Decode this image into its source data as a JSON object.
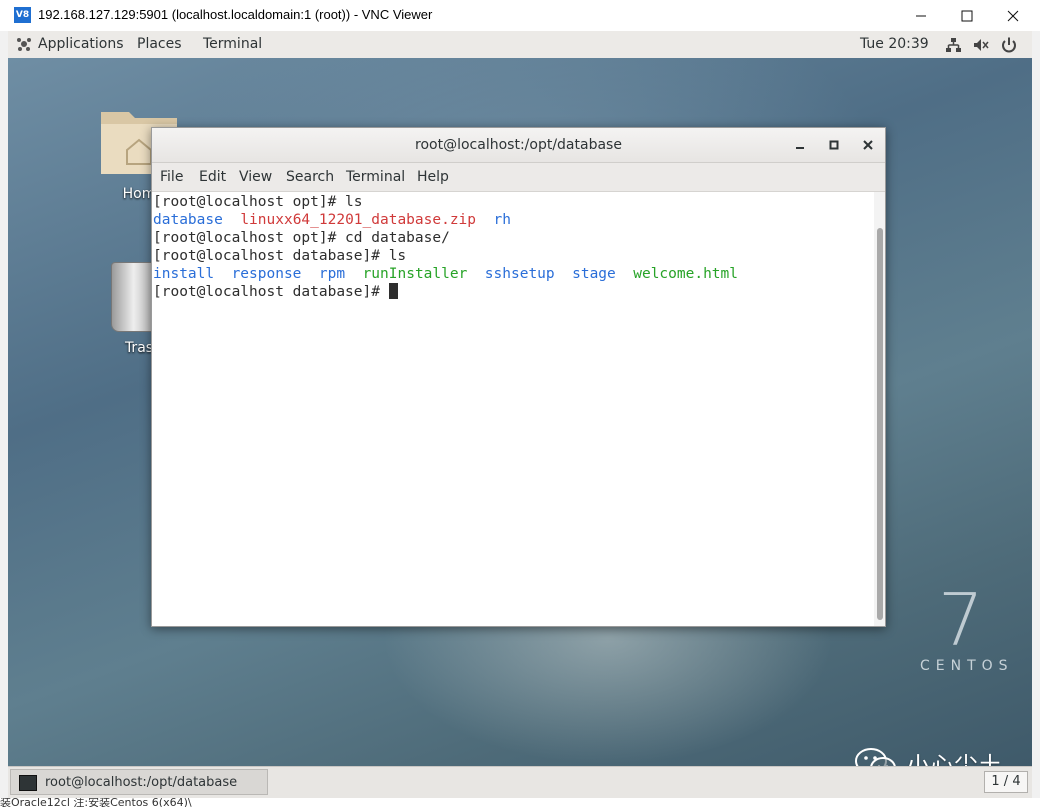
{
  "vnc": {
    "logo": "V8",
    "title": "192.168.127.129:5901 (localhost.localdomain:1 (root)) - VNC Viewer"
  },
  "topbar": {
    "applications": "Applications",
    "places": "Places",
    "terminal": "Terminal",
    "clock": "Tue 20:39"
  },
  "desktop": {
    "home_label": "Hom",
    "trash_label": "Tras",
    "centos_number": "7",
    "centos_word": "CENTOS",
    "watermark": "小心尘土"
  },
  "terminal": {
    "title": "root@localhost:/opt/database",
    "menu": [
      "File",
      "Edit",
      "View",
      "Search",
      "Terminal",
      "Help"
    ],
    "lines": {
      "l1": "[root@localhost opt]# ls",
      "l2_a": "database",
      "l2_b": "linuxx64_12201_database.zip",
      "l2_c": "rh",
      "l3": "[root@localhost opt]# cd database/",
      "l4": "[root@localhost database]# ls",
      "l5_a": "install",
      "l5_b": "response",
      "l5_c": "rpm",
      "l5_d": "runInstaller",
      "l5_e": "sshsetup",
      "l5_f": "stage",
      "l5_g": "welcome.html",
      "l6": "[root@localhost database]# "
    }
  },
  "taskbar": {
    "item": "root@localhost:/opt/database",
    "pager": "1 / 4"
  },
  "background_strips": {
    "bottom": "装Oracle12cl    注:安装Centos 6(x64)\\"
  },
  "colors": {
    "dir_blue": "#2a6ed8",
    "archive_red": "#d03a3a",
    "exec_green": "#27a327"
  }
}
